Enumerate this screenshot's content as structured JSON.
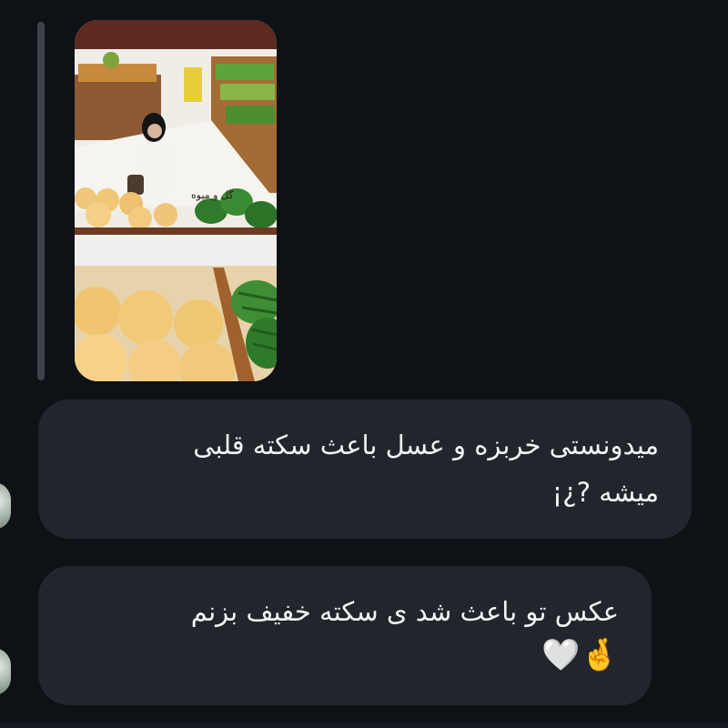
{
  "message_top_caption": "",
  "image_message": {
    "sticker_text": "گل و میوه"
  },
  "messages": [
    {
      "text_line1": "میدونستی خربزه و عسل باعث سکته قلبی",
      "text_line2": "میشه ?¿¡"
    },
    {
      "text_line1": "عکس تو باعث شد ی سکته خفیف بزنم",
      "emoji": "🤞🤍"
    }
  ]
}
